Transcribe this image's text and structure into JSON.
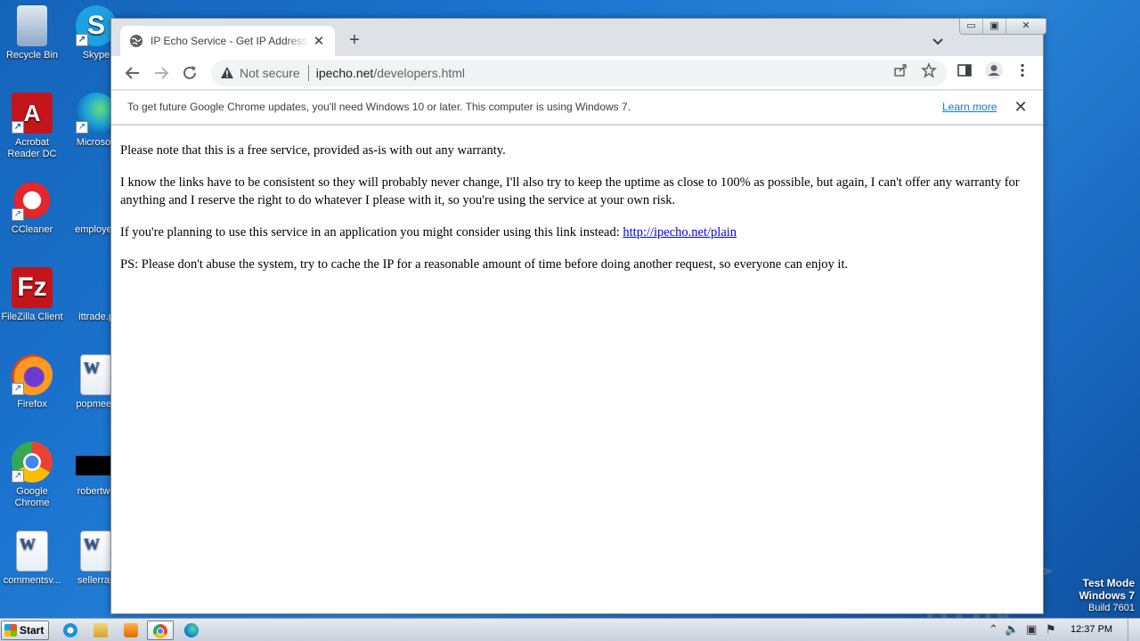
{
  "desktop": {
    "icons_col1": [
      {
        "label": "Recycle Bin",
        "icon": "recycle-bin-icon"
      },
      {
        "label": "Acrobat Reader DC",
        "icon": "acrobat-icon"
      },
      {
        "label": "CCleaner",
        "icon": "ccleaner-icon"
      },
      {
        "label": "FileZilla Client",
        "icon": "filezilla-icon"
      },
      {
        "label": "Firefox",
        "icon": "firefox-icon"
      },
      {
        "label": "Google Chrome",
        "icon": "chrome-icon"
      },
      {
        "label": "commentsv...",
        "icon": "word-doc-icon"
      }
    ],
    "icons_col2": [
      {
        "label": "Skype",
        "icon": "skype-icon"
      },
      {
        "label": "Microsoft",
        "icon": "edge-icon"
      },
      {
        "label": "employee",
        "icon": "file-icon"
      },
      {
        "label": "ittrade.p",
        "icon": "file-icon"
      },
      {
        "label": "popmeeti",
        "icon": "word-doc-icon"
      },
      {
        "label": "robertwe",
        "icon": "black-file-icon"
      },
      {
        "label": "sellerrap",
        "icon": "word-doc-icon"
      }
    ],
    "watermark": "ANY ▷ RUN",
    "test_mode": {
      "line1": "Test Mode",
      "line2": "Windows 7",
      "line3": "Build 7601"
    }
  },
  "browser": {
    "tab_title": "IP Echo Service - Get IP Address pro",
    "new_tab": "+",
    "window_controls": [
      "▭",
      "▣",
      "✕"
    ],
    "address": {
      "security_label": "Not secure",
      "host": "ipecho.net",
      "path": "/developers.html"
    },
    "infobar": {
      "message": "To get future Google Chrome updates, you'll need Windows 10 or later. This computer is using Windows 7.",
      "link": "Learn more"
    },
    "page": {
      "p1": "Please note that this is a free service, provided as-is with out any warranty.",
      "p2": "I know the links have to be consistent so they will probably never change, I'll also try to keep the uptime as close to 100% as possible, but again, I can't offer any warranty for anything and I reserve the right to do whatever I please with it, so you're using the service at your own risk.",
      "p3_prefix": "If you're planning to use this service in an application you might consider using this link instead: ",
      "p3_link": "http://ipecho.net/plain",
      "p4": "PS: Please don't abuse the system, try to cache the IP for a reasonable amount of time before doing another request, so everyone can enjoy it."
    }
  },
  "taskbar": {
    "start_label": "Start",
    "clock": "12:37 PM",
    "pinned": [
      "ie-icon",
      "explorer-icon",
      "media-player-icon",
      "chrome-icon",
      "edge-icon"
    ]
  }
}
